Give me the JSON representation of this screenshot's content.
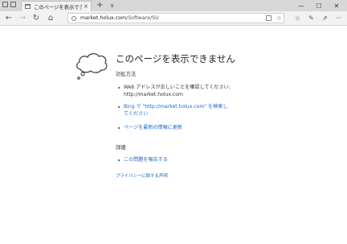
{
  "tab": {
    "title": "このページを表示できません",
    "close": "×"
  },
  "newtab": {
    "label": "+"
  },
  "tablist": {
    "label": "∨"
  },
  "window": {
    "minimize": "—",
    "maximize": "☐",
    "close": "✕"
  },
  "nav": {
    "back": "←",
    "forward": "→",
    "refresh": "↻",
    "home": "⌂"
  },
  "address": {
    "domain": "market.holux.com",
    "path": "/Software/SU",
    "favorite": "☆"
  },
  "toolbar": {
    "favorites_hub": "☆",
    "pen": "✎",
    "share": "⇗",
    "more": "···"
  },
  "error": {
    "title": "このページを表示できません",
    "steps_heading": "対処方法",
    "step1_line1": "Web アドレスが正しいことを確認してください:",
    "step1_line2": "http://market.holux.com",
    "step2_line1": "Bing で \"http://market.holux.com\" を検索し",
    "step2_line2": "てください",
    "step3": "ページを最新の情報に更新",
    "details_heading": "詳細",
    "report": "この問題を報告する",
    "privacy": "プライバシーに関する声明"
  },
  "colors": {
    "link": "#1b6ac9",
    "chrome": "#d7d7d7",
    "navbar": "#f2f2f2"
  }
}
